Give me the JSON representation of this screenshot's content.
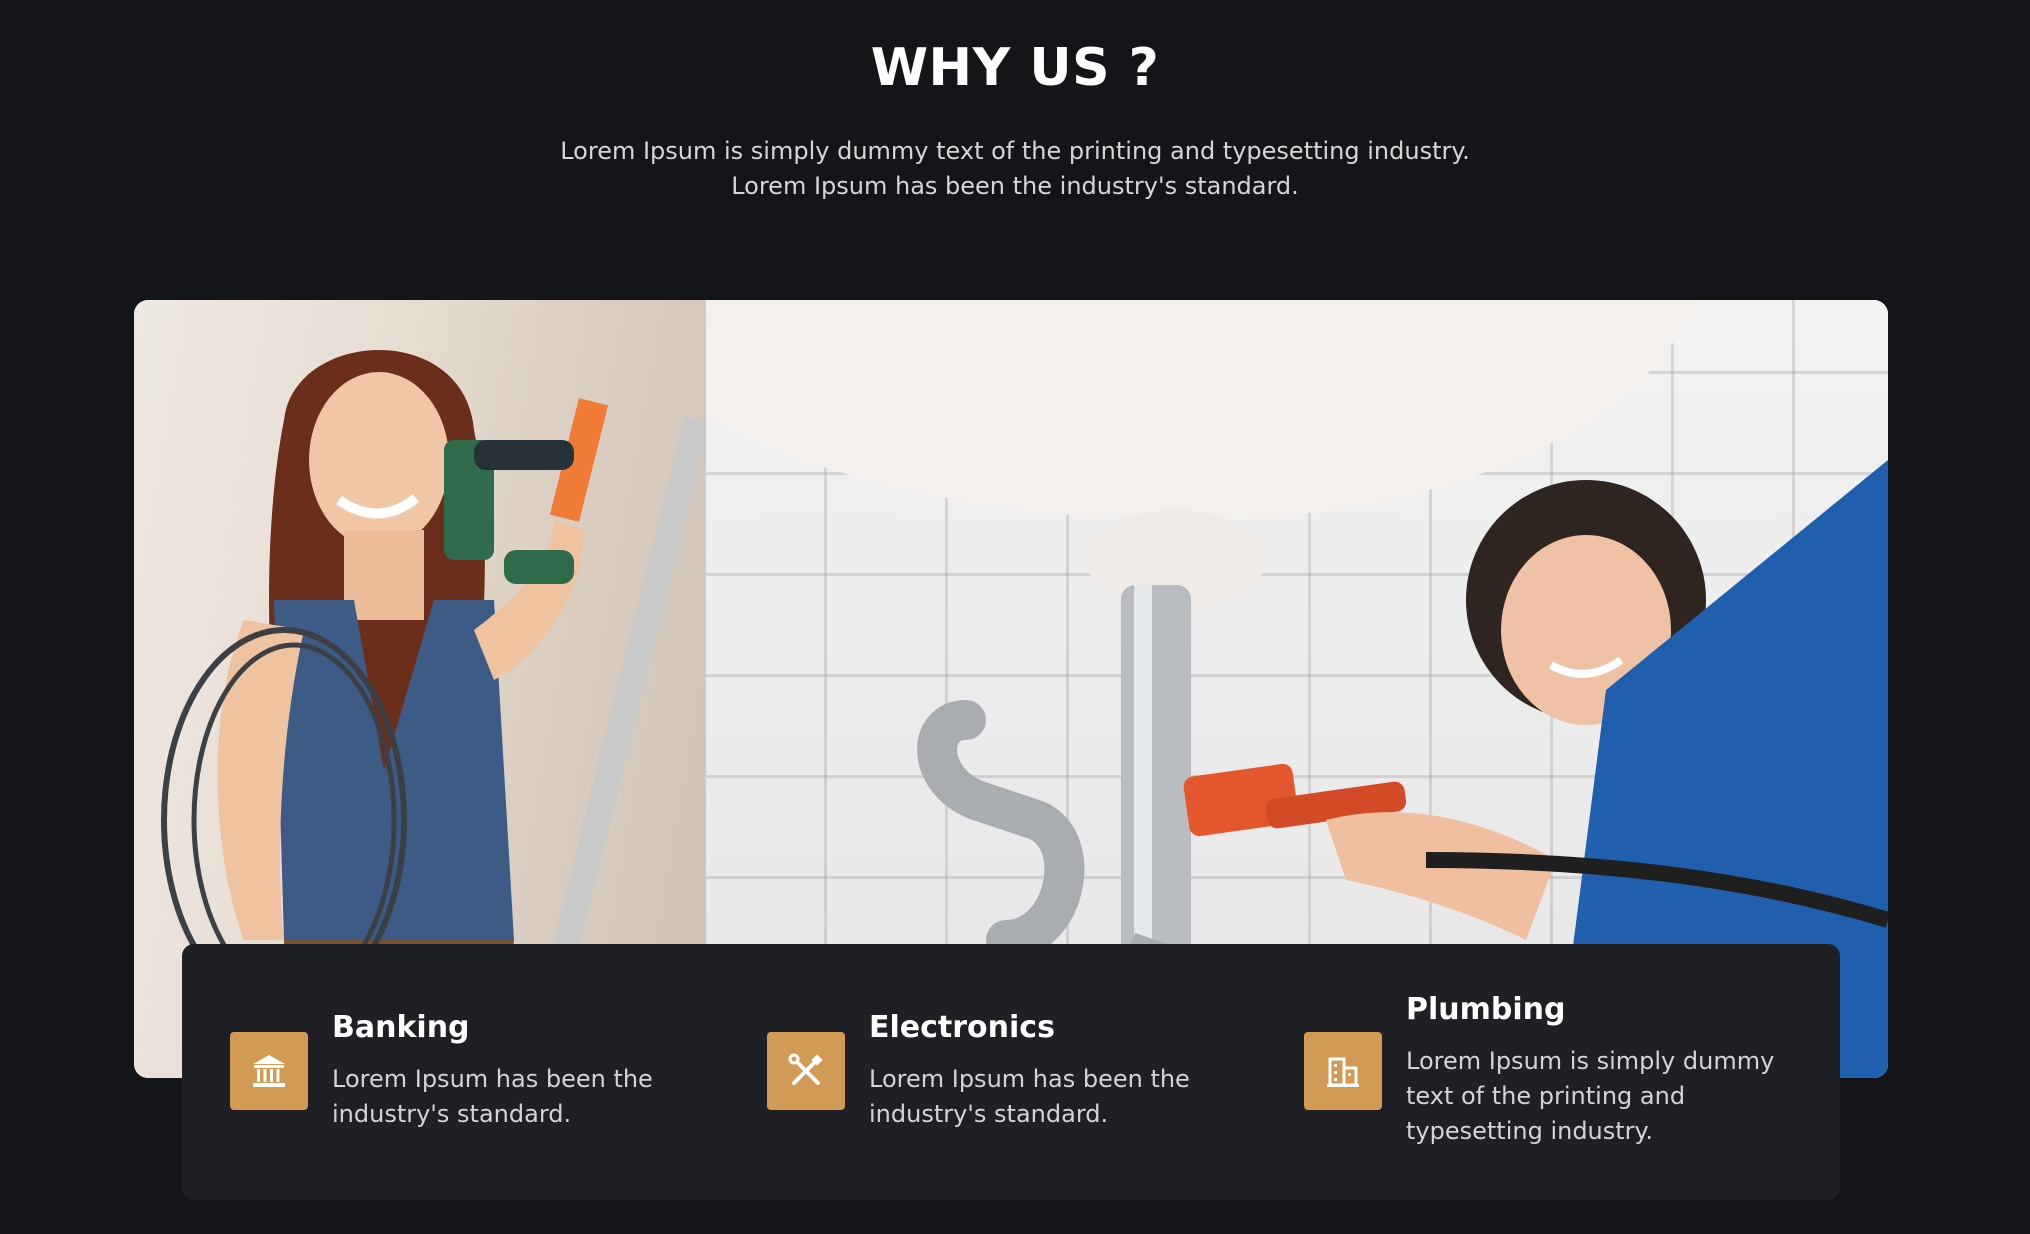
{
  "section": {
    "title": "WHY US ?",
    "subtitle_line1": "Lorem Ipsum is simply dummy text of the printing and typesetting industry.",
    "subtitle_line2": "Lorem Ipsum has been the industry's standard."
  },
  "features": [
    {
      "title": "Banking",
      "text": "Lorem Ipsum has been the industry's standard.",
      "icon": "bank-icon"
    },
    {
      "title": "Electronics",
      "text": "Lorem Ipsum has been the industry's standard.",
      "icon": "tools-icon"
    },
    {
      "title": "Plumbing",
      "text": "Lorem Ipsum is simply dummy text of the printing and typesetting industry.",
      "icon": "building-icon"
    }
  ],
  "colors": {
    "background": "#141519",
    "panel": "#1f2025",
    "accent": "#d19a55"
  }
}
